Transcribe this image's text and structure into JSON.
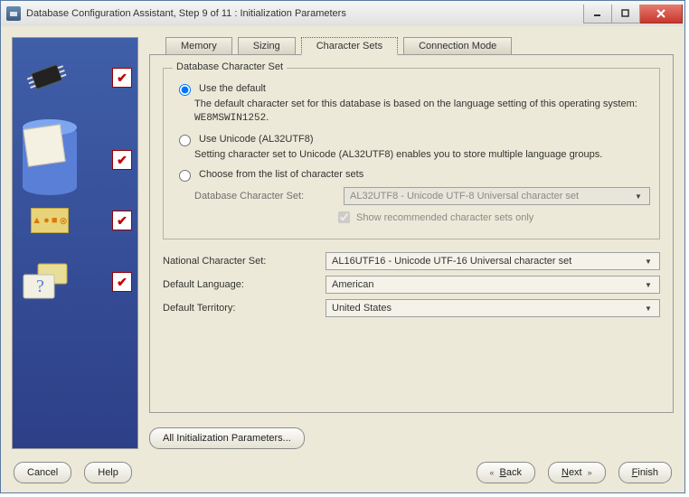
{
  "window": {
    "title": "Database Configuration Assistant, Step 9 of 11 : Initialization Parameters"
  },
  "tabs": {
    "memory": "Memory",
    "sizing": "Sizing",
    "charsets": "Character Sets",
    "connmode": "Connection Mode"
  },
  "group": {
    "title": "Database Character Set",
    "opt_default": {
      "label": "Use the default",
      "desc_prefix": "The default character set for this database is based on the language setting of this operating system: ",
      "os_charset": "WE8MSWIN1252",
      "desc_suffix": "."
    },
    "opt_unicode": {
      "label": "Use Unicode (AL32UTF8)",
      "desc": "Setting character set to Unicode (AL32UTF8) enables you to store multiple language groups."
    },
    "opt_choose": {
      "label": "Choose from the list of character sets",
      "combo_label": "Database Character Set:",
      "combo_value": "AL32UTF8 - Unicode UTF-8 Universal character set",
      "show_recommended_label": "Show recommended character sets only"
    }
  },
  "national": {
    "label": "National Character Set:",
    "value": "AL16UTF16 - Unicode UTF-16 Universal character set"
  },
  "default_language": {
    "label": "Default Language:",
    "value": "American"
  },
  "default_territory": {
    "label": "Default Territory:",
    "value": "United States"
  },
  "all_params_button": "All Initialization Parameters...",
  "footer": {
    "cancel": "Cancel",
    "help": "Help",
    "back": "Back",
    "next": "Next",
    "finish": "Finish"
  },
  "sidebar": {
    "items": [
      {
        "name": "chip-icon",
        "checked": true
      },
      {
        "name": "db-docs-icon",
        "checked": true
      },
      {
        "name": "db-shapes-icon",
        "checked": true
      },
      {
        "name": "help-folders-icon",
        "checked": true
      }
    ]
  }
}
